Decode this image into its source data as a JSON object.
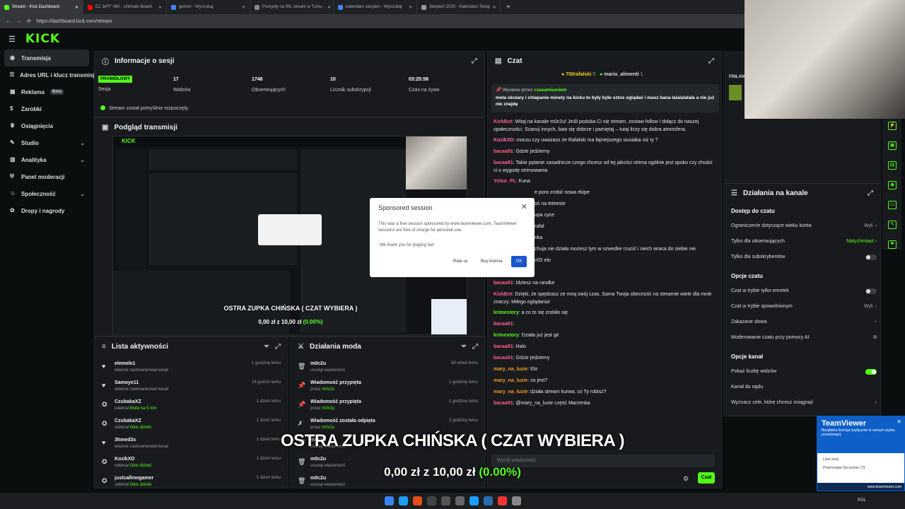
{
  "browser": {
    "tabs": [
      {
        "label": "Stream - Kick Dashboard",
        "color": "#53fc18",
        "active": true
      },
      {
        "label": "DJ JeFF #80 - Ultimate Beach",
        "color": "#ff0000"
      },
      {
        "label": "gemini - Wyszukaj",
        "color": "#4285f4"
      },
      {
        "label": "Pomysły na IRL stream w Turku -",
        "color": "#888888"
      },
      {
        "label": "kalendarz sierpien - Wyszukaj",
        "color": "#4285f4"
      },
      {
        "label": "Sierpień 2026 - Kalendarz Świąt",
        "color": "#999999"
      }
    ],
    "new_tab": "+",
    "url": "https://dashboard.kick.com/stream"
  },
  "site": {
    "logo": "KICK",
    "menu_icon": "hamburger-icon"
  },
  "sidebar": {
    "items": [
      {
        "label": "Transmisja",
        "icon": "broadcast-icon",
        "active": true
      },
      {
        "label": "Adres URL i klucz transmisji",
        "icon": "link-icon"
      },
      {
        "label": "Reklama",
        "icon": "ad-icon",
        "badge": "Beta"
      },
      {
        "label": "Zarobki",
        "icon": "money-icon"
      },
      {
        "label": "Osiągnięcia",
        "icon": "trophy-icon"
      },
      {
        "label": "Studio",
        "icon": "studio-icon",
        "chevron": true
      },
      {
        "label": "Analityka",
        "icon": "chart-icon",
        "chevron": true
      },
      {
        "label": "Panel moderacji",
        "icon": "shield-icon"
      },
      {
        "label": "Społeczność",
        "icon": "people-icon",
        "chevron": true
      },
      {
        "label": "Dropy i nagrody",
        "icon": "gift-icon"
      }
    ]
  },
  "session": {
    "title": "Informacje o sesji",
    "status_badge": "PRAWIDŁOWY",
    "status_label": "Sesja",
    "stats": [
      {
        "value": "17",
        "label": "Widzów"
      },
      {
        "value": "1748",
        "label": "Obserwujących"
      },
      {
        "value": "10",
        "label": "Licznik subskrypcji"
      },
      {
        "value": "03:25:58",
        "label": "Czas na żywo"
      }
    ],
    "message": "Stream został pomyślnie rozpoczęty."
  },
  "preview": {
    "title": "Podgląd transmisji",
    "overlay_title": "OSTRA ZUPKA CHIŃSKA ( CZAT WYBIERA )",
    "overlay_amount": "0,00 zł z 10,00 zł",
    "overlay_pct": "(0.00%)"
  },
  "activity": {
    "title": "Lista aktywności",
    "rows": [
      {
        "user": "elemele1",
        "action": "właśnie zaobserwował kanał",
        "time": "1 godzinę temu",
        "icon": "heart-icon"
      },
      {
        "user": "Samoye11",
        "action": "właśnie zaobserwował kanał",
        "time": "19 godzin temu",
        "icon": "heart-icon"
      },
      {
        "user": "CzubakaXZ",
        "action": "odebrał",
        "reward": "Mute na 5 min",
        "time": "1 dzień temu",
        "icon": "reward-icon"
      },
      {
        "user": "CzubakaXZ",
        "action": "odebrał",
        "reward": "Głos dziwki",
        "time": "1 dzień temu",
        "icon": "reward-icon"
      },
      {
        "user": "3hmed3x",
        "action": "właśnie zaobserwował kanał",
        "time": "1 dzień temu",
        "icon": "heart-icon"
      },
      {
        "user": "KozikXD",
        "action": "odebrał",
        "reward": "Głos dziwki",
        "time": "1 dzień temu",
        "icon": "reward-icon"
      },
      {
        "user": "justcallmegamer",
        "action": "odebrał",
        "reward": "Głos dziwki",
        "time": "1 dzień temu",
        "icon": "reward-icon"
      }
    ]
  },
  "modactions": {
    "title": "Działania moda",
    "rows": [
      {
        "title": "m0c2u",
        "sub": "usunął wiadomość",
        "time": "58 minut temu",
        "icon": "trash-icon"
      },
      {
        "title": "Wiadomość przypięta",
        "sub": "przez",
        "by": "m0c2u",
        "time": "1 godzinę temu",
        "icon": "pin-icon"
      },
      {
        "title": "Wiadomość przypięta",
        "sub": "przez",
        "by": "m0c2u",
        "time": "1 godzinę temu",
        "icon": "pin-icon"
      },
      {
        "title": "Wiadomość została odpięta",
        "sub": "przez",
        "by": "m0c2u",
        "time": "2 godziny temu",
        "icon": "unpin-icon"
      },
      {
        "title": "m0c2u",
        "sub": "usunął wiadomość",
        "time": "",
        "icon": "trash-icon"
      },
      {
        "title": "m0c2u",
        "sub": "usunął wiadomość",
        "time": "",
        "icon": "trash-icon"
      },
      {
        "title": "m0c2u",
        "sub": "usunął wiadomość",
        "time": "",
        "icon": "trash-icon"
      }
    ]
  },
  "chat": {
    "title": "Czat",
    "top_users": [
      {
        "name": "700rafalski",
        "count": "5"
      },
      {
        "name": "mario_alimenti",
        "count": "1"
      }
    ],
    "pinned_by_label": "Wysłane przez",
    "pinned_by": "czasamiumiem",
    "pinned_text": "meta okulary i chlapanie minety na kicku to były było sztos oglądać i masz bana lalalalalala a nie już nie znajdę",
    "messages": [
      {
        "user": "KickBot",
        "cls": "ur",
        "text": ": Witaj na kanale m0c2u! Jeśli podoba Ci się stream, zostaw follow i dołącz do naszej społeczności. Szanuj innych, baw się dobrze i pamiętaj – tutaj liczy się dobra atmosfera."
      },
      {
        "user": "KozikXD",
        "cls": "up",
        "text": ": moczu czy uważasz że Rafalski ma fajniejszego siusiaka niż ty ?"
      },
      {
        "user": "bacaa91",
        "cls": "ur",
        "text": ": Gdzie jedziemy"
      },
      {
        "user": "bacaa91",
        "cls": "ur",
        "text": ": Takie pytanie zasadnicze czego chcesz od tej jakości strima ogólnie jest spoko czy chodzi ci o wygodę strimowania"
      },
      {
        "user": "Yoloo_PL",
        "cls": "ur",
        "text": ": Kuna"
      },
      {
        "user": "",
        "cls": "",
        "text": "e pora zrobić nowa ekipe"
      },
      {
        "user": "",
        "cls": "",
        "text": "oś na teteesie"
      },
      {
        "user": "",
        "cls": "",
        "text": "upa cyce"
      },
      {
        "user": "",
        "cls": "",
        "text": "rafal"
      },
      {
        "user": "",
        "cls": "",
        "text": "nka"
      },
      {
        "user": "",
        "cls": "",
        "text": "chuja nie działa możesz tym w szwedke rzucić i niech wraca do siebie nie"
      },
      {
        "user": "Yoloo_PL",
        "cls": "ur",
        "text": ": @KozikXD elo"
      },
      {
        "user": "Yoloo_PL",
        "cls": "ur",
        "text": ":"
      },
      {
        "user": "bacaa91",
        "cls": "ur",
        "text": ": Idziesz na randke"
      },
      {
        "user": "KickBot",
        "cls": "ur",
        "text": ": Dzięki, że spędzasz ze mną swój czas. Sama Twoja obecność na streamie wiele dla mnie znaczy. Miłego oglądania!"
      },
      {
        "user": "krimestory",
        "cls": "ug",
        "text": ": a co to się zrobiło się"
      },
      {
        "user": "bacaa91",
        "cls": "ur",
        "text": ":"
      },
      {
        "user": "krimestory",
        "cls": "ug",
        "text": ": Działa już jest git"
      },
      {
        "user": "bacaa91",
        "cls": "ur",
        "text": ": Halo"
      },
      {
        "user": "bacaa91",
        "cls": "ur",
        "text": ": Gdzie jedziemy"
      },
      {
        "user": "mary_na_luzie",
        "cls": "uo",
        "text": ": Elo"
      },
      {
        "user": "mary_na_luzie",
        "cls": "uo",
        "text": ": co jest?"
      },
      {
        "user": "mary_na_luzie",
        "cls": "uo",
        "text": ": działa stream kurwa, co Ty robisz?"
      },
      {
        "user": "bacaa91",
        "cls": "ur",
        "text": ": @mary_na_luzie część Marzenka"
      }
    ],
    "input_placeholder": "Wyślij wiadomość",
    "send_label": "Czat"
  },
  "dialog": {
    "title": "Sponsored session",
    "body": "This was a free session sponsored by www.teamviewer.com. TeamViewer sessions are free of charge for personal use.",
    "thanks": "We thank you for playing fair!",
    "rate": "Rate us",
    "buy": "Buy license",
    "ok": "OK"
  },
  "channel": {
    "title": "Działania na kanale",
    "sections": [
      {
        "title": "Dostęp do czatu",
        "items": [
          {
            "label": "Ograniczenie dotyczące wieku konta",
            "value": "Wył.",
            "kind": "value"
          },
          {
            "label": "Tylko dla obserwujących",
            "value": "Natychmiast",
            "kind": "value-green"
          },
          {
            "label": "Tylko dla subskrybentów",
            "kind": "toggle-off"
          }
        ]
      },
      {
        "title": "Opcje czatu",
        "items": [
          {
            "label": "Czat w trybie tylko emotek",
            "kind": "toggle-off"
          },
          {
            "label": "Czat w trybie spowolnionym",
            "value": "Wył.",
            "kind": "value"
          },
          {
            "label": "Zakazane słowa",
            "kind": "arrow"
          },
          {
            "label": "Moderowanie czatu przy pomocy AI",
            "kind": "external"
          }
        ]
      },
      {
        "title": "Opcje kanał",
        "items": [
          {
            "label": "Pokaż liczbę widzów",
            "kind": "toggle-on"
          },
          {
            "label": "Kanał do rajdu",
            "kind": "none"
          },
          {
            "label": "Wyznacz cele, które chcesz osiągnąć",
            "kind": "arrow"
          }
        ]
      }
    ],
    "side_label": "FINLAN"
  },
  "overlay": {
    "title": "OSTRA ZUPKA CHIŃSKA ( CZAT WYBIERA )",
    "amount": "0,00 zł z 10,00 zł",
    "pct": "(0.00%)"
  },
  "teamviewer": {
    "title": "TeamViewer",
    "sub": "Bezpłatna licencja (wyłącznie w ramach użytku prywatnego)",
    "list": "Lista sesji",
    "user": "Przemysław Szczesiuk (79",
    "footer": "www.teamviewer.com"
  },
  "taskbar": {
    "lang": "POL"
  },
  "colors": {
    "accent": "#53fc18",
    "panel": "#181a1d",
    "bg": "#0b0e0f"
  }
}
